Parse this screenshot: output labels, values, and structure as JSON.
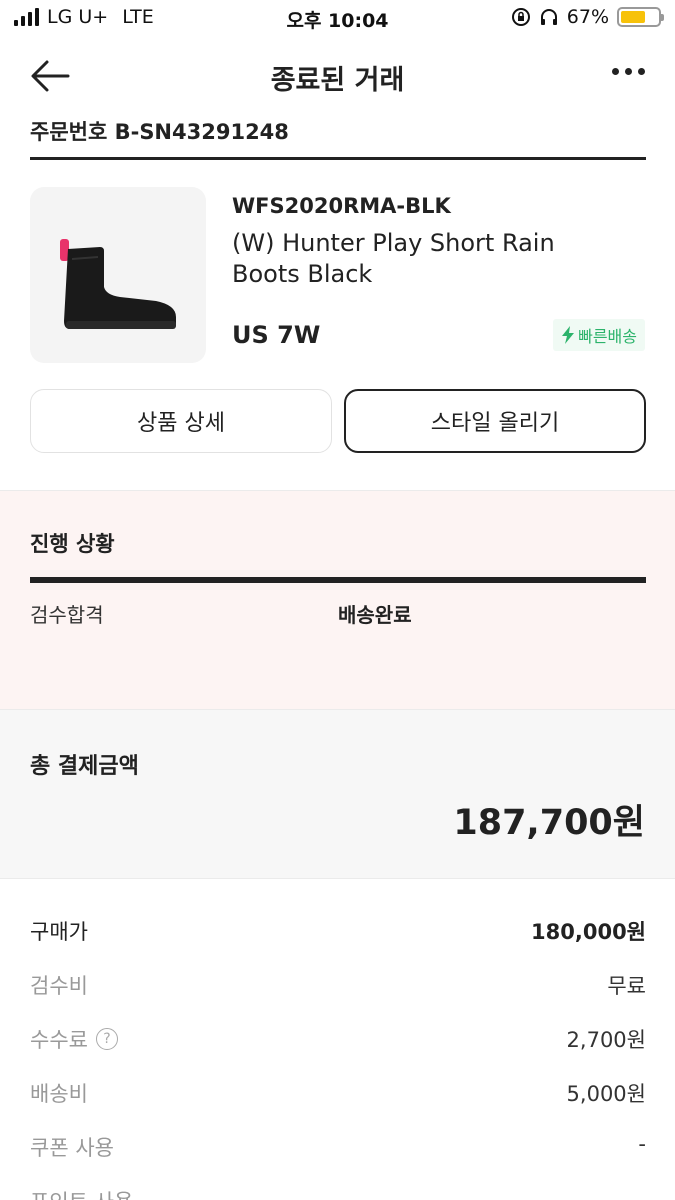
{
  "status_bar": {
    "carrier": "LG U+",
    "network": "LTE",
    "time": "오후 10:04",
    "battery": "67%",
    "battery_level": 0.67
  },
  "header": {
    "title": "종료된 거래"
  },
  "order": {
    "number": "주문번호 B-SN43291248"
  },
  "product": {
    "model": "WFS2020RMA-BLK",
    "name": "(W) Hunter Play Short Rain Boots Black",
    "size": "US 7W",
    "badge": "빠른배송",
    "badge_color": "#2cb36b"
  },
  "buttons": {
    "detail": "상품 상세",
    "style": "스타일 올리기"
  },
  "progress": {
    "title": "진행 상황",
    "steps": [
      "검수합격",
      "배송완료"
    ]
  },
  "payment": {
    "total_label": "총 결제금액",
    "total_value": "187,700원",
    "rows": [
      {
        "label": "구매가",
        "value": "180,000원"
      },
      {
        "label": "검수비",
        "value": "무료"
      },
      {
        "label": "수수료",
        "value": "2,700원"
      },
      {
        "label": "배송비",
        "value": "5,000원"
      },
      {
        "label": "쿠폰 사용",
        "value": "-"
      },
      {
        "label": "포인트 사용",
        "value": ""
      }
    ]
  }
}
